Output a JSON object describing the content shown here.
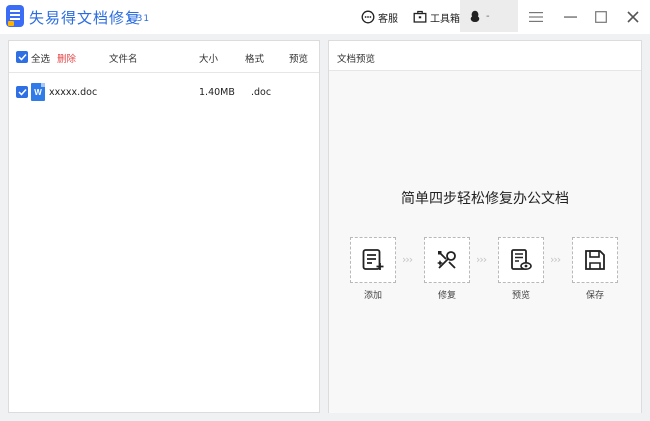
{
  "app": {
    "title": "失易得文档修复",
    "version": "1.31"
  },
  "toolbar": {
    "service_label": "客服",
    "toolbox_label": "工具箱",
    "account_label": "-"
  },
  "file_list": {
    "select_all_label": "全选",
    "delete_label": "删除",
    "columns": {
      "name": "文件名",
      "size": "大小",
      "format": "格式",
      "preview": "预览"
    },
    "rows": [
      {
        "name": "xxxxx.doc",
        "size": "1.40MB",
        "format": ".doc",
        "checked": true,
        "icon": "word-doc-icon"
      }
    ]
  },
  "preview": {
    "title": "文档预览",
    "intro": "简单四步轻松修复办公文档",
    "steps": [
      {
        "label": "添加",
        "icon": "add-document-icon"
      },
      {
        "label": "修复",
        "icon": "repair-tools-icon"
      },
      {
        "label": "预览",
        "icon": "preview-document-icon"
      },
      {
        "label": "保存",
        "icon": "save-disk-icon"
      }
    ],
    "arrow": "›››"
  },
  "colors": {
    "accent": "#2f6fe4",
    "delete": "#e64646",
    "title": "#2b6de0"
  }
}
